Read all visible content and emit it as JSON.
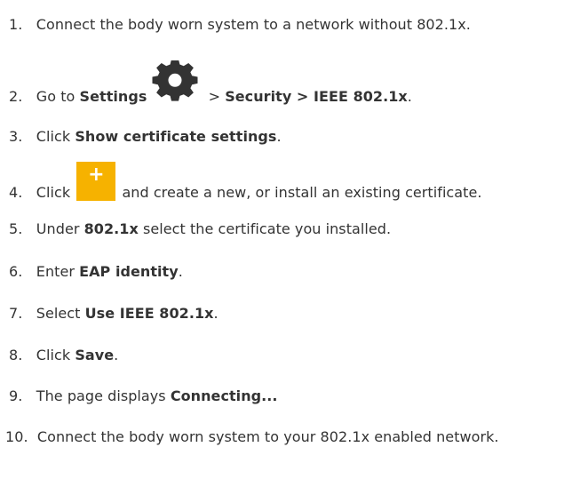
{
  "steps": [
    {
      "number": "1.",
      "parts": [
        "Connect the body worn system to a network without 802.1x."
      ]
    },
    {
      "number": "2.",
      "parts": [
        "Go to ",
        "Settings",
        " > ",
        "Security > IEEE 802.1x",
        "."
      ]
    },
    {
      "number": "3.",
      "parts": [
        "Click ",
        "Show certificate settings",
        "."
      ]
    },
    {
      "number": "4.",
      "parts": [
        "Click ",
        " and create a new, or install an existing certificate."
      ]
    },
    {
      "number": "5.",
      "parts": [
        "Under ",
        "802.1x",
        " select the certificate you installed."
      ]
    },
    {
      "number": "6.",
      "parts": [
        "Enter ",
        "EAP identity",
        "."
      ]
    },
    {
      "number": "7.",
      "parts": [
        "Select ",
        "Use IEEE 802.1x",
        "."
      ]
    },
    {
      "number": "8.",
      "parts": [
        "Click ",
        "Save",
        "."
      ]
    },
    {
      "number": "9.",
      "parts": [
        "The page displays ",
        "Connecting..."
      ]
    },
    {
      "number": "10.",
      "parts": [
        "Connect the body worn system to your 802.1x enabled network."
      ]
    }
  ],
  "icons": {
    "settings_icon": "gear-icon",
    "add_icon": "plus-icon",
    "add_icon_glyph": "+",
    "add_icon_color": "#f6b200",
    "text_color": "#333333"
  }
}
